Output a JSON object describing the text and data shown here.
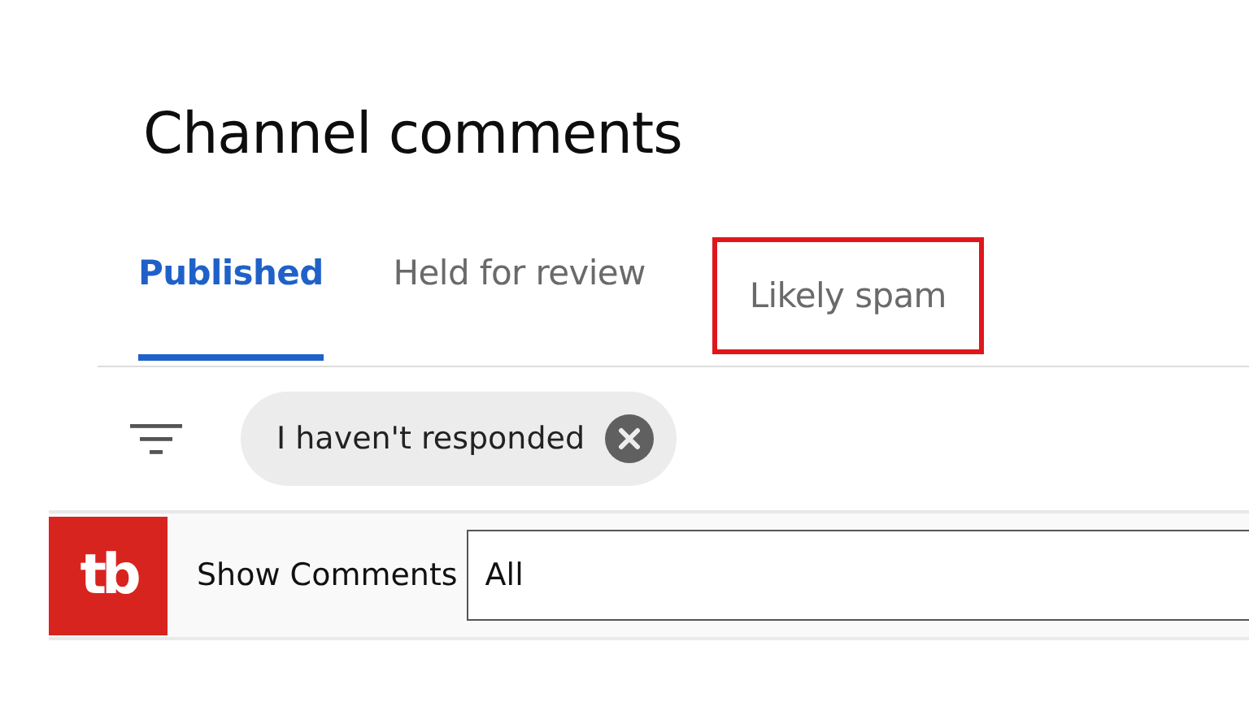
{
  "page_title": "Channel comments",
  "tabs": [
    {
      "label": "Published",
      "selected": true,
      "highlighted": false
    },
    {
      "label": "Held for review",
      "selected": false,
      "highlighted": false
    },
    {
      "label": "Likely spam",
      "selected": false,
      "highlighted": true
    }
  ],
  "filter_chips": [
    {
      "label": "I haven't responded"
    }
  ],
  "extension_bar": {
    "logo": "tb",
    "label": "Show Comments",
    "select_value": "All"
  }
}
